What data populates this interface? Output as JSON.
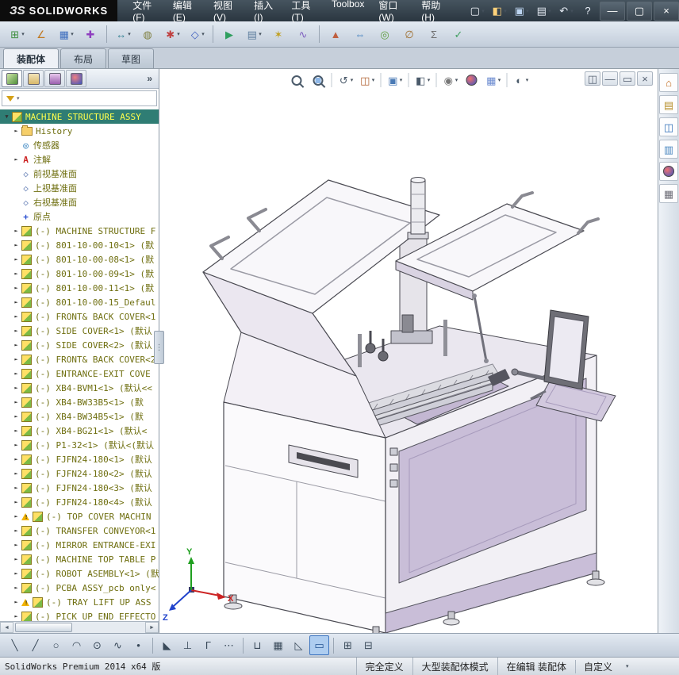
{
  "titlebar": {
    "logo": "ЗS",
    "brand": "SOLIDWORKS",
    "menus": [
      "文件(F)",
      "编辑(E)",
      "视图(V)",
      "插入(I)",
      "工具(T)",
      "Toolbox",
      "窗口(W)",
      "帮助(H)"
    ],
    "quick_tools": [
      {
        "name": "new-document",
        "dd": true
      },
      {
        "name": "open-document",
        "dd": true
      },
      {
        "name": "save-document",
        "dd": true
      },
      {
        "name": "print-document",
        "dd": true
      },
      {
        "name": "undo",
        "dd": true
      },
      {
        "name": "help"
      }
    ],
    "window_controls": [
      {
        "name": "minimize-window"
      },
      {
        "name": "maximize-window"
      },
      {
        "name": "close-window"
      }
    ]
  },
  "toolbar": {
    "items": [
      {
        "name": "insert-components",
        "dd": true
      },
      {
        "name": "mate"
      },
      {
        "name": "linear-component-pattern",
        "dd": true
      },
      {
        "name": "smart-fasteners"
      },
      {
        "sep": true
      },
      {
        "name": "move-component",
        "dd": true
      },
      {
        "name": "show-hidden-components"
      },
      {
        "name": "assembly-features",
        "dd": true
      },
      {
        "name": "reference-geometry",
        "dd": true
      },
      {
        "sep": true
      },
      {
        "name": "new-motion-study"
      },
      {
        "name": "bill-of-materials",
        "dd": true
      },
      {
        "name": "exploded-view"
      },
      {
        "name": "explode-line-sketch"
      },
      {
        "sep": true
      },
      {
        "name": "interference-detection"
      },
      {
        "name": "clearance-verification"
      },
      {
        "name": "hole-alignment"
      },
      {
        "name": "measure"
      },
      {
        "name": "mass-properties"
      },
      {
        "name": "performance-evaluation"
      }
    ]
  },
  "commandmanager": {
    "tabs": [
      {
        "label": "装配体",
        "key": "assembly",
        "active": true
      },
      {
        "label": "布局",
        "key": "layout",
        "active": false
      },
      {
        "label": "草图",
        "key": "sketch",
        "active": false
      }
    ]
  },
  "feature_tree": {
    "panel_tabs": [
      "featuremanager",
      "propertymanager",
      "configurationmanager",
      "displaymanager"
    ],
    "expand_label": "»",
    "items": [
      {
        "label": "MACHINE STRUCTURE ASSY",
        "icon": "assembly",
        "caret": "down",
        "selected": true,
        "indent": 0
      },
      {
        "label": "History",
        "icon": "history",
        "caret": "right",
        "indent": 1
      },
      {
        "label": "传感器",
        "icon": "sensors",
        "indent": 1
      },
      {
        "label": "注解",
        "icon": "annotations",
        "caret": "right",
        "indent": 1
      },
      {
        "label": "前视基准面",
        "icon": "plane",
        "indent": 1
      },
      {
        "label": "上视基准面",
        "icon": "plane",
        "indent": 1
      },
      {
        "label": "右视基准面",
        "icon": "plane",
        "indent": 1
      },
      {
        "label": "原点",
        "icon": "origin",
        "indent": 1
      },
      {
        "label": "(-) MACHINE STRUCTURE F",
        "icon": "assembly",
        "caret": "right",
        "indent": 1
      },
      {
        "label": "(-) 801-10-00-10<1> (默",
        "icon": "assembly",
        "caret": "right",
        "indent": 1
      },
      {
        "label": "(-) 801-10-00-08<1> (默",
        "icon": "assembly",
        "caret": "right",
        "indent": 1
      },
      {
        "label": "(-) 801-10-00-09<1> (默",
        "icon": "assembly",
        "caret": "right",
        "indent": 1
      },
      {
        "label": "(-) 801-10-00-11<1> (默",
        "icon": "assembly",
        "caret": "right",
        "indent": 1
      },
      {
        "label": "(-) 801-10-00-15_Defaul",
        "icon": "assembly",
        "caret": "right",
        "indent": 1
      },
      {
        "label": "(-) FRONT& BACK COVER<1",
        "icon": "assembly",
        "caret": "right",
        "indent": 1
      },
      {
        "label": "(-) SIDE COVER<1> (默认",
        "icon": "assembly",
        "caret": "right",
        "indent": 1
      },
      {
        "label": "(-) SIDE COVER<2> (默认",
        "icon": "assembly",
        "caret": "right",
        "indent": 1
      },
      {
        "label": "(-) FRONT& BACK COVER<2",
        "icon": "assembly",
        "caret": "right",
        "indent": 1
      },
      {
        "label": "(-) ENTRANCE-EXIT COVE",
        "icon": "assembly",
        "caret": "right",
        "indent": 1
      },
      {
        "label": "(-) XB4-BVM1<1> (默认<<",
        "icon": "assembly",
        "caret": "right",
        "indent": 1
      },
      {
        "label": "(-) XB4-BW33B5<1> (默",
        "icon": "assembly",
        "caret": "right",
        "indent": 1
      },
      {
        "label": "(-) XB4-BW34B5<1> (默",
        "icon": "assembly",
        "caret": "right",
        "indent": 1
      },
      {
        "label": "(-) XB4-BG21<1> (默认<",
        "icon": "assembly",
        "caret": "right",
        "indent": 1
      },
      {
        "label": "(-) P1-32<1> (默认<(默认",
        "icon": "assembly",
        "caret": "right",
        "indent": 1
      },
      {
        "label": "(-) FJFN24-180<1> (默认",
        "icon": "assembly",
        "caret": "right",
        "indent": 1
      },
      {
        "label": "(-) FJFN24-180<2> (默认",
        "icon": "assembly",
        "caret": "right",
        "indent": 1
      },
      {
        "label": "(-) FJFN24-180<3> (默认",
        "icon": "assembly",
        "caret": "right",
        "indent": 1
      },
      {
        "label": "(-) FJFN24-180<4> (默认",
        "icon": "assembly",
        "caret": "right",
        "indent": 1
      },
      {
        "label": "(-) TOP COVER MACHIN",
        "icon": "assembly",
        "caret": "right",
        "warning": true,
        "indent": 1
      },
      {
        "label": "(-) TRANSFER CONVEYOR<1",
        "icon": "assembly",
        "caret": "right",
        "indent": 1
      },
      {
        "label": "(-) MIRROR ENTRANCE-EXI",
        "icon": "assembly",
        "caret": "right",
        "indent": 1
      },
      {
        "label": "(-) MACHINE TOP TABLE P",
        "icon": "assembly",
        "caret": "right",
        "indent": 1
      },
      {
        "label": "(-) ROBOT ASEMBLY<1> (默",
        "icon": "assembly",
        "caret": "right",
        "indent": 1
      },
      {
        "label": "(-) PCBA ASSY_pcb only<",
        "icon": "assembly",
        "caret": "right",
        "indent": 1
      },
      {
        "label": "(-) TRAY LIFT UP ASS",
        "icon": "assembly",
        "caret": "right",
        "warning": true,
        "indent": 1
      },
      {
        "label": "(-) PICK UP END EFFECTO",
        "icon": "assembly",
        "caret": "right",
        "indent": 1
      }
    ]
  },
  "viewport": {
    "headsup": [
      {
        "name": "zoom-to-fit"
      },
      {
        "name": "zoom-to-area"
      },
      {
        "sep": true
      },
      {
        "name": "previous-view",
        "dd": true
      },
      {
        "name": "section-view",
        "dd": true
      },
      {
        "sep": true
      },
      {
        "name": "view-orientation",
        "dd": true
      },
      {
        "sep": true
      },
      {
        "name": "display-style",
        "dd": true
      },
      {
        "sep": true
      },
      {
        "name": "hide-show-items",
        "dd": true
      },
      {
        "name": "edit-appearance"
      },
      {
        "name": "apply-scene",
        "dd": true
      },
      {
        "sep": true
      },
      {
        "name": "view-settings",
        "dd": true
      }
    ],
    "doc_controls": [
      {
        "name": "doc-split"
      },
      {
        "name": "doc-minimize"
      },
      {
        "name": "doc-restore"
      },
      {
        "name": "doc-close"
      }
    ],
    "triad": {
      "x": "X",
      "y": "Y",
      "z": "Z"
    }
  },
  "task_pane": {
    "icons": [
      {
        "name": "solidworks-resources"
      },
      {
        "name": "design-library"
      },
      {
        "name": "file-explorer"
      },
      {
        "name": "view-palette"
      },
      {
        "name": "appearances-scenes"
      },
      {
        "name": "custom-properties"
      }
    ]
  },
  "sketch_toolbar": {
    "items": [
      {
        "name": "line"
      },
      {
        "name": "centerline"
      },
      {
        "name": "circle"
      },
      {
        "name": "tangent-arc"
      },
      {
        "name": "ellipse"
      },
      {
        "name": "spline"
      },
      {
        "name": "point"
      },
      {
        "sep": true
      },
      {
        "name": "mirror-entities"
      },
      {
        "name": "convert-entities"
      },
      {
        "name": "sketch-fillet"
      },
      {
        "name": "construction-geometry"
      },
      {
        "sep": true
      },
      {
        "name": "straight-slot"
      },
      {
        "name": "grid-snap"
      },
      {
        "name": "polygon"
      },
      {
        "name": "corner-rectangle",
        "selected": true
      },
      {
        "sep": true
      },
      {
        "name": "add-relation"
      },
      {
        "name": "display-relations"
      }
    ]
  },
  "status_bar": {
    "left_text": "SolidWorks Premium 2014 x64 版",
    "modes": [
      "完全定义",
      "大型装配体模式",
      "在编辑 装配体"
    ],
    "custom_label": "自定义"
  }
}
